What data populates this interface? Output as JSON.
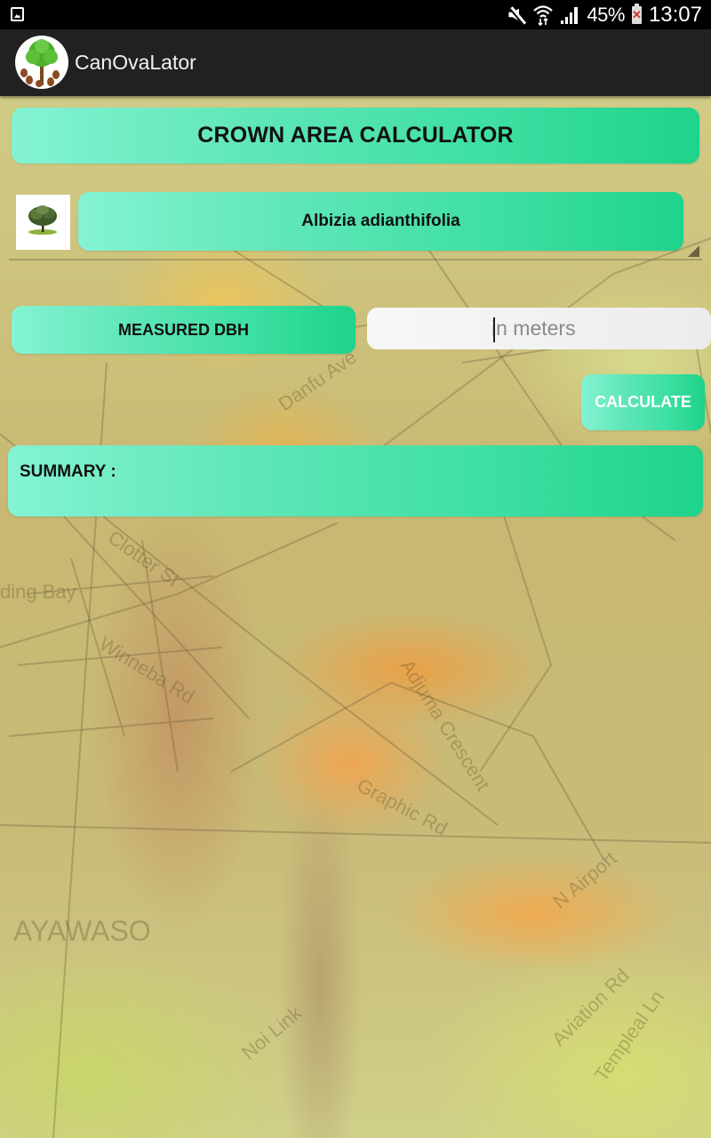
{
  "status_bar": {
    "left_icon": "image-notification-icon",
    "icons": [
      "mute-icon",
      "wifi-icon",
      "signal-icon"
    ],
    "battery_percent": "45%",
    "battery_icon": "battery-charging-error-icon",
    "time": "13:07"
  },
  "app_bar": {
    "title": "CanOvaLator",
    "logo": "tree-logo-icon"
  },
  "main": {
    "title": "CROWN AREA CALCULATOR",
    "species": {
      "thumbnail": "tree-thumbnail-icon",
      "selected": "Albizia adianthifolia"
    },
    "dbh": {
      "label": "MEASURED DBH",
      "value": "",
      "placeholder": "in meters"
    },
    "calculate_label": "CALCULATE",
    "summary_label": "SUMMARY :",
    "summary_value": ""
  },
  "background_map_labels": [
    "ding Bay",
    "Winneba Rd",
    "Adjuma Crescent",
    "Graphic Rd",
    "AYAWASO",
    "N Airport",
    "Aviation Rd",
    "Templeal Ln",
    "Noi Link",
    "Danfu Ave",
    "Clotter St"
  ],
  "colors": {
    "gradient_start": "#84f3d2",
    "gradient_end": "#1ed38b",
    "app_bar": "#212121",
    "status_bar": "#000000"
  }
}
